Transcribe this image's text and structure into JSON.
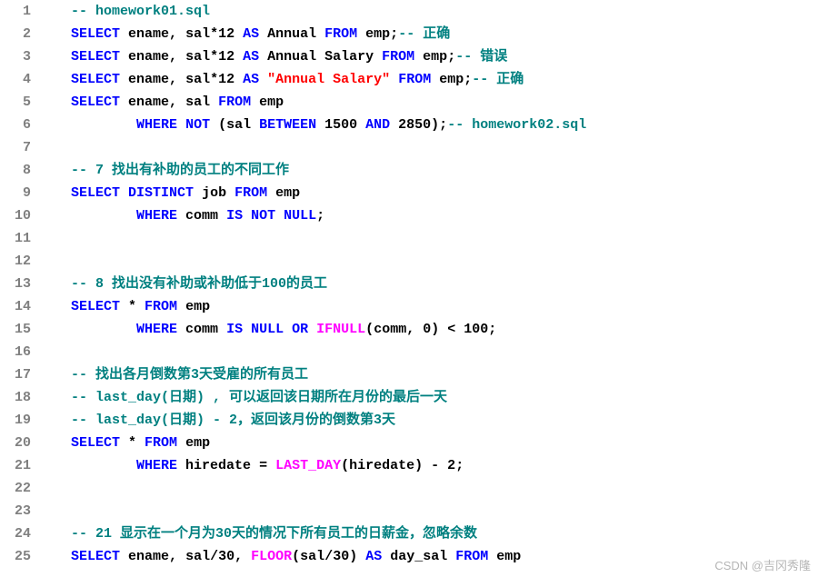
{
  "watermark": "CSDN @吉冈秀隆",
  "lines": [
    {
      "n": 1,
      "indent": 1,
      "tokens": [
        {
          "t": "-- homework01.sql",
          "c": "c-comment"
        }
      ]
    },
    {
      "n": 2,
      "indent": 1,
      "tokens": [
        {
          "t": "SELECT",
          "c": "c-kw"
        },
        {
          "t": " ename",
          "c": "c-plain"
        },
        {
          "t": ",",
          "c": "c-punct"
        },
        {
          "t": " sal",
          "c": "c-plain"
        },
        {
          "t": "*",
          "c": "c-punct"
        },
        {
          "t": "12 ",
          "c": "c-num"
        },
        {
          "t": "AS",
          "c": "c-kw"
        },
        {
          "t": " Annual ",
          "c": "c-plain"
        },
        {
          "t": "FROM",
          "c": "c-kw"
        },
        {
          "t": " emp",
          "c": "c-plain"
        },
        {
          "t": ";",
          "c": "c-punct"
        },
        {
          "t": "-- 正确",
          "c": "c-comment"
        }
      ]
    },
    {
      "n": 3,
      "indent": 1,
      "tokens": [
        {
          "t": "SELECT",
          "c": "c-kw"
        },
        {
          "t": " ename",
          "c": "c-plain"
        },
        {
          "t": ",",
          "c": "c-punct"
        },
        {
          "t": " sal",
          "c": "c-plain"
        },
        {
          "t": "*",
          "c": "c-punct"
        },
        {
          "t": "12 ",
          "c": "c-num"
        },
        {
          "t": "AS",
          "c": "c-kw"
        },
        {
          "t": " Annual Salary ",
          "c": "c-plain"
        },
        {
          "t": "FROM",
          "c": "c-kw"
        },
        {
          "t": " emp",
          "c": "c-plain"
        },
        {
          "t": ";",
          "c": "c-punct"
        },
        {
          "t": "-- 错误",
          "c": "c-comment"
        }
      ]
    },
    {
      "n": 4,
      "indent": 1,
      "tokens": [
        {
          "t": "SELECT",
          "c": "c-kw"
        },
        {
          "t": " ename",
          "c": "c-plain"
        },
        {
          "t": ",",
          "c": "c-punct"
        },
        {
          "t": " sal",
          "c": "c-plain"
        },
        {
          "t": "*",
          "c": "c-punct"
        },
        {
          "t": "12 ",
          "c": "c-num"
        },
        {
          "t": "AS",
          "c": "c-kw"
        },
        {
          "t": " ",
          "c": "c-plain"
        },
        {
          "t": "\"Annual Salary\"",
          "c": "c-str"
        },
        {
          "t": " ",
          "c": "c-plain"
        },
        {
          "t": "FROM",
          "c": "c-kw"
        },
        {
          "t": " emp",
          "c": "c-plain"
        },
        {
          "t": ";",
          "c": "c-punct"
        },
        {
          "t": "-- 正确",
          "c": "c-comment"
        }
      ]
    },
    {
      "n": 5,
      "indent": 1,
      "tokens": [
        {
          "t": "SELECT",
          "c": "c-kw"
        },
        {
          "t": " ename",
          "c": "c-plain"
        },
        {
          "t": ",",
          "c": "c-punct"
        },
        {
          "t": " sal ",
          "c": "c-plain"
        },
        {
          "t": "FROM",
          "c": "c-kw"
        },
        {
          "t": " emp",
          "c": "c-plain"
        }
      ]
    },
    {
      "n": 6,
      "indent": 3,
      "tokens": [
        {
          "t": "WHERE",
          "c": "c-kw"
        },
        {
          "t": " ",
          "c": "c-plain"
        },
        {
          "t": "NOT",
          "c": "c-kw"
        },
        {
          "t": " (",
          "c": "c-punct"
        },
        {
          "t": "sal ",
          "c": "c-plain"
        },
        {
          "t": "BETWEEN",
          "c": "c-kw"
        },
        {
          "t": " 1500 ",
          "c": "c-num"
        },
        {
          "t": "AND",
          "c": "c-kw"
        },
        {
          "t": " 2850",
          "c": "c-num"
        },
        {
          "t": ");",
          "c": "c-punct"
        },
        {
          "t": "-- homework02.sql",
          "c": "c-comment"
        }
      ]
    },
    {
      "n": 7,
      "indent": 0,
      "tokens": []
    },
    {
      "n": 8,
      "indent": 1,
      "tokens": [
        {
          "t": "-- 7 找出有补助的员工的不同工作",
          "c": "c-comment"
        }
      ]
    },
    {
      "n": 9,
      "indent": 1,
      "tokens": [
        {
          "t": "SELECT",
          "c": "c-kw"
        },
        {
          "t": " ",
          "c": "c-plain"
        },
        {
          "t": "DISTINCT",
          "c": "c-kw"
        },
        {
          "t": " job ",
          "c": "c-plain"
        },
        {
          "t": "FROM",
          "c": "c-kw"
        },
        {
          "t": " emp",
          "c": "c-plain"
        }
      ]
    },
    {
      "n": 10,
      "indent": 3,
      "tokens": [
        {
          "t": "WHERE",
          "c": "c-kw"
        },
        {
          "t": " comm ",
          "c": "c-plain"
        },
        {
          "t": "IS",
          "c": "c-kw"
        },
        {
          "t": " ",
          "c": "c-plain"
        },
        {
          "t": "NOT",
          "c": "c-kw"
        },
        {
          "t": " ",
          "c": "c-plain"
        },
        {
          "t": "NULL",
          "c": "c-kw"
        },
        {
          "t": ";",
          "c": "c-punct"
        }
      ]
    },
    {
      "n": 11,
      "indent": 0,
      "tokens": []
    },
    {
      "n": 12,
      "indent": 0,
      "tokens": []
    },
    {
      "n": 13,
      "indent": 1,
      "tokens": [
        {
          "t": "-- 8 找出没有补助或补助低于100的员工",
          "c": "c-comment"
        }
      ]
    },
    {
      "n": 14,
      "indent": 1,
      "tokens": [
        {
          "t": "SELECT",
          "c": "c-kw"
        },
        {
          "t": " * ",
          "c": "c-punct"
        },
        {
          "t": "FROM",
          "c": "c-kw"
        },
        {
          "t": " emp",
          "c": "c-plain"
        }
      ]
    },
    {
      "n": 15,
      "indent": 3,
      "tokens": [
        {
          "t": "WHERE",
          "c": "c-kw"
        },
        {
          "t": " comm ",
          "c": "c-plain"
        },
        {
          "t": "IS",
          "c": "c-kw"
        },
        {
          "t": " ",
          "c": "c-plain"
        },
        {
          "t": "NULL",
          "c": "c-kw"
        },
        {
          "t": " ",
          "c": "c-plain"
        },
        {
          "t": "OR",
          "c": "c-kw"
        },
        {
          "t": " ",
          "c": "c-plain"
        },
        {
          "t": "IFNULL",
          "c": "c-func"
        },
        {
          "t": "(",
          "c": "c-punct"
        },
        {
          "t": "comm",
          "c": "c-plain"
        },
        {
          "t": ",",
          "c": "c-punct"
        },
        {
          "t": " 0",
          "c": "c-num"
        },
        {
          "t": ")",
          "c": "c-punct"
        },
        {
          "t": " < ",
          "c": "c-punct"
        },
        {
          "t": "100",
          "c": "c-num"
        },
        {
          "t": ";",
          "c": "c-punct"
        }
      ]
    },
    {
      "n": 16,
      "indent": 0,
      "tokens": []
    },
    {
      "n": 17,
      "indent": 1,
      "tokens": [
        {
          "t": "-- 找出各月倒数第3天受雇的所有员工",
          "c": "c-comment"
        }
      ]
    },
    {
      "n": 18,
      "indent": 1,
      "tokens": [
        {
          "t": "-- last_day(日期) , 可以返回该日期所在月份的最后一天",
          "c": "c-comment"
        }
      ]
    },
    {
      "n": 19,
      "indent": 1,
      "tokens": [
        {
          "t": "-- last_day(日期) - 2，返回该月份的倒数第3天",
          "c": "c-comment"
        }
      ]
    },
    {
      "n": 20,
      "indent": 1,
      "tokens": [
        {
          "t": "SELECT",
          "c": "c-kw"
        },
        {
          "t": " * ",
          "c": "c-punct"
        },
        {
          "t": "FROM",
          "c": "c-kw"
        },
        {
          "t": " emp",
          "c": "c-plain"
        }
      ]
    },
    {
      "n": 21,
      "indent": 3,
      "tokens": [
        {
          "t": "WHERE",
          "c": "c-kw"
        },
        {
          "t": " hiredate ",
          "c": "c-plain"
        },
        {
          "t": "=",
          "c": "c-punct"
        },
        {
          "t": " ",
          "c": "c-plain"
        },
        {
          "t": "LAST_DAY",
          "c": "c-func"
        },
        {
          "t": "(",
          "c": "c-punct"
        },
        {
          "t": "hiredate",
          "c": "c-plain"
        },
        {
          "t": ")",
          "c": "c-punct"
        },
        {
          "t": " - ",
          "c": "c-punct"
        },
        {
          "t": "2",
          "c": "c-num"
        },
        {
          "t": ";",
          "c": "c-punct"
        }
      ]
    },
    {
      "n": 22,
      "indent": 0,
      "tokens": []
    },
    {
      "n": 23,
      "indent": 0,
      "tokens": []
    },
    {
      "n": 24,
      "indent": 1,
      "tokens": [
        {
          "t": "-- 21 显示在一个月为30天的情况下所有员工的日薪金，忽略余数",
          "c": "c-comment"
        }
      ]
    },
    {
      "n": 25,
      "indent": 1,
      "tokens": [
        {
          "t": "SELECT",
          "c": "c-kw"
        },
        {
          "t": " ename",
          "c": "c-plain"
        },
        {
          "t": ",",
          "c": "c-punct"
        },
        {
          "t": " sal",
          "c": "c-plain"
        },
        {
          "t": "/",
          "c": "c-punct"
        },
        {
          "t": "30",
          "c": "c-num"
        },
        {
          "t": ",",
          "c": "c-punct"
        },
        {
          "t": " ",
          "c": "c-plain"
        },
        {
          "t": "FLOOR",
          "c": "c-func"
        },
        {
          "t": "(",
          "c": "c-punct"
        },
        {
          "t": "sal",
          "c": "c-plain"
        },
        {
          "t": "/",
          "c": "c-punct"
        },
        {
          "t": "30",
          "c": "c-num"
        },
        {
          "t": ")",
          "c": "c-punct"
        },
        {
          "t": " ",
          "c": "c-plain"
        },
        {
          "t": "AS",
          "c": "c-kw"
        },
        {
          "t": " day_sal ",
          "c": "c-plain"
        },
        {
          "t": "FROM",
          "c": "c-kw"
        },
        {
          "t": " emp",
          "c": "c-plain"
        }
      ]
    }
  ]
}
